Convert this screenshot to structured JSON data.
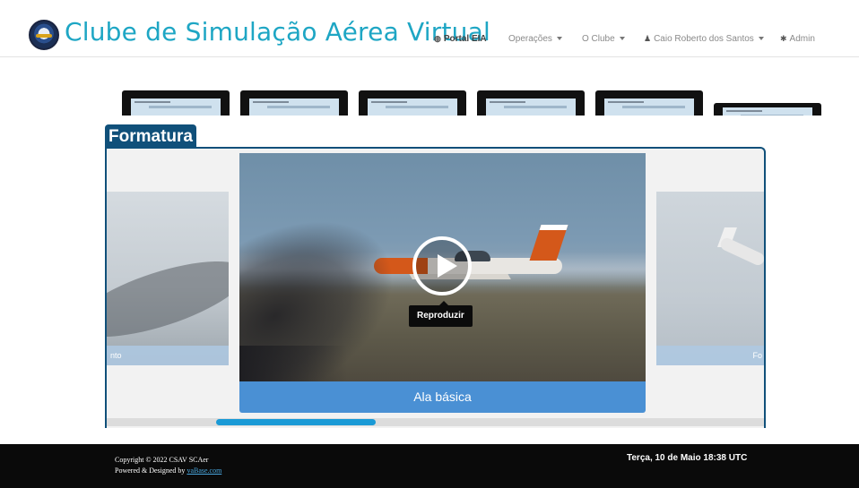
{
  "header": {
    "site_title": "Clube de Simulação Aérea Virtual",
    "logo_icon": "club-emblem-icon",
    "nav": {
      "portal": "Portal EIA",
      "operacoes": "Operações",
      "clube": "O Clube",
      "user": "Caio Roberto dos Santos",
      "admin": "Admin"
    }
  },
  "thumbnails": [
    "thumb-1",
    "thumb-2",
    "thumb-3",
    "thumb-4",
    "thumb-5",
    "thumb-6"
  ],
  "section": {
    "title": "Formatura"
  },
  "carousel": {
    "left_caption": "nto",
    "right_caption": "Fo",
    "main_caption": "Ala básica",
    "tooltip": "Reproduzir"
  },
  "footer": {
    "copyright": "Copyright © 2022 CSAV SCAer",
    "powered_prefix": "Powered & Designed by ",
    "powered_link": "vaBase.com",
    "datetime": "Terça, 10 de Maio 18:38 UTC"
  },
  "colors": {
    "brand": "#1ea6c4",
    "section": "#10507a",
    "caption": "#4a90d4",
    "scroll": "#1a9ad6"
  }
}
